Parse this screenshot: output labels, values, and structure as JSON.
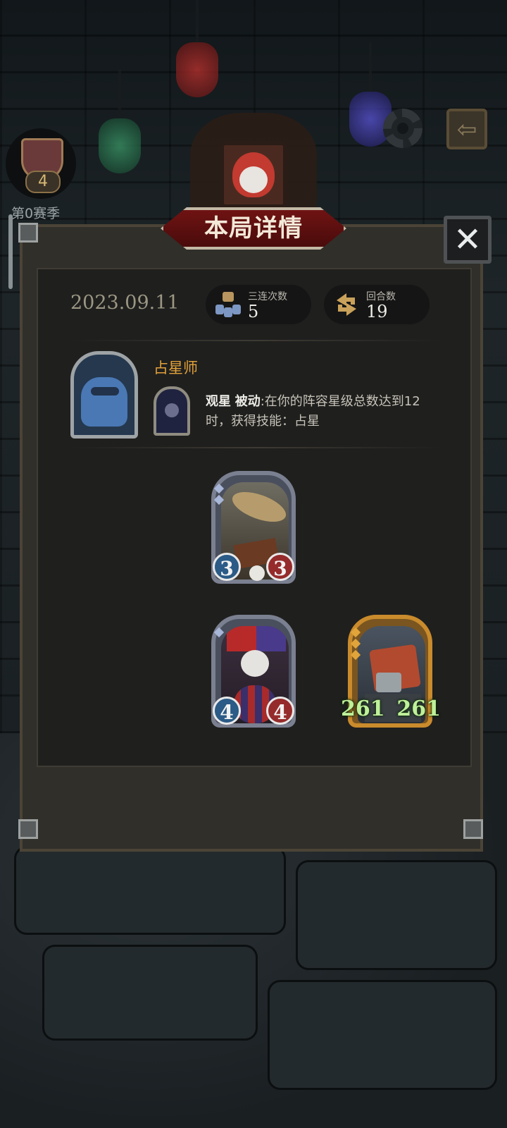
{
  "top_bar": {
    "rank_level": "4",
    "season_label": "第0赛季",
    "settings_icon": "gear-icon",
    "back_icon": "exit-arrow-icon"
  },
  "dialog": {
    "title": "本局详情",
    "close_symbol": "✕",
    "date": "2023.09.11",
    "stats": {
      "triples_label": "三连次数",
      "triples_value": "5",
      "rounds_label": "回合数",
      "rounds_value": "19"
    },
    "hero": {
      "name": "占星师",
      "skill_name": "观星",
      "skill_type": "被动",
      "skill_desc": ":在你的阵容星级总数达到12时，获得技能：占星"
    },
    "units": [
      {
        "name": "airship-unit",
        "attack": "3",
        "health": "3",
        "frame": "silver",
        "stars": 2
      },
      {
        "name": "clown-unit",
        "attack": "4",
        "health": "4",
        "frame": "silver",
        "stars": 1
      },
      {
        "name": "robot-unit",
        "attack": "261",
        "health": "261",
        "frame": "gold",
        "stars": 3
      }
    ]
  },
  "colors": {
    "accent_gold": "#e2a23a",
    "banner_red": "#6f1313",
    "attack_blue": "#2b5b86",
    "health_red": "#962b2b",
    "buffed_green": "#bff09a"
  }
}
